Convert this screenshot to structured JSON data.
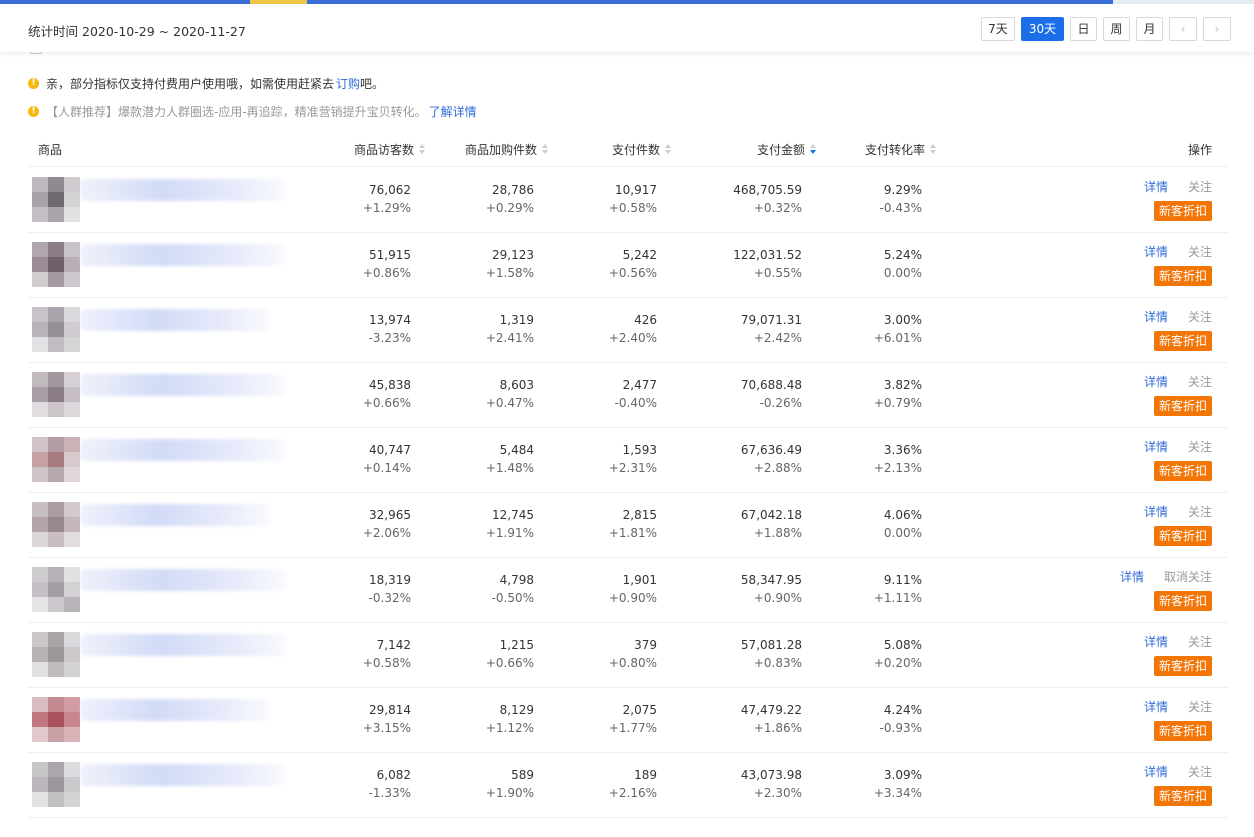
{
  "header": {
    "period_label": "统计时间",
    "date_start": "2020-10-29",
    "date_sep": "~",
    "date_end": "2020-11-27",
    "buttons": {
      "d7": "7天",
      "d30": "30天",
      "day": "日",
      "week": "周",
      "month": "月",
      "prev": "‹",
      "next": "›"
    },
    "active_button": "30天"
  },
  "notices": [
    {
      "text": "亲，部分指标仅支持付费用户使用哦，如需使用赶紧去",
      "link": "订购",
      "suffix": "吧。"
    },
    {
      "text": "【人群推荐】爆款潜力人群圈选-应用-再追踪，精准营销提升宝贝转化。",
      "link": "了解详情",
      "suffix": ""
    }
  ],
  "table": {
    "columns": {
      "product": "商品",
      "visitors": "商品访客数",
      "cart": "商品加购件数",
      "paid_items": "支付件数",
      "paid_amount": "支付金额",
      "conversion": "支付转化率",
      "actions": "操作"
    },
    "rows": [
      {
        "visitors": "76,062",
        "visitors_chg": "+1.29%",
        "cart": "28,786",
        "cart_chg": "+0.29%",
        "paid_items": "10,917",
        "paid_items_chg": "+0.58%",
        "amount": "468,705.59",
        "amount_chg": "+0.32%",
        "conv": "9.29%",
        "conv_chg": "-0.43%",
        "detail": "详情",
        "follow": "关注",
        "promo": "新客折扣"
      },
      {
        "visitors": "51,915",
        "visitors_chg": "+0.86%",
        "cart": "29,123",
        "cart_chg": "+1.58%",
        "paid_items": "5,242",
        "paid_items_chg": "+0.56%",
        "amount": "122,031.52",
        "amount_chg": "+0.55%",
        "conv": "5.24%",
        "conv_chg": "0.00%",
        "detail": "详情",
        "follow": "关注",
        "promo": "新客折扣"
      },
      {
        "visitors": "13,974",
        "visitors_chg": "-3.23%",
        "cart": "1,319",
        "cart_chg": "+2.41%",
        "paid_items": "426",
        "paid_items_chg": "+2.40%",
        "amount": "79,071.31",
        "amount_chg": "+2.42%",
        "conv": "3.00%",
        "conv_chg": "+6.01%",
        "detail": "详情",
        "follow": "关注",
        "promo": "新客折扣"
      },
      {
        "visitors": "45,838",
        "visitors_chg": "+0.66%",
        "cart": "8,603",
        "cart_chg": "+0.47%",
        "paid_items": "2,477",
        "paid_items_chg": "-0.40%",
        "amount": "70,688.48",
        "amount_chg": "-0.26%",
        "conv": "3.82%",
        "conv_chg": "+0.79%",
        "detail": "详情",
        "follow": "关注",
        "promo": "新客折扣"
      },
      {
        "visitors": "40,747",
        "visitors_chg": "+0.14%",
        "cart": "5,484",
        "cart_chg": "+1.48%",
        "paid_items": "1,593",
        "paid_items_chg": "+2.31%",
        "amount": "67,636.49",
        "amount_chg": "+2.88%",
        "conv": "3.36%",
        "conv_chg": "+2.13%",
        "detail": "详情",
        "follow": "关注",
        "promo": "新客折扣"
      },
      {
        "visitors": "32,965",
        "visitors_chg": "+2.06%",
        "cart": "12,745",
        "cart_chg": "+1.91%",
        "paid_items": "2,815",
        "paid_items_chg": "+1.81%",
        "amount": "67,042.18",
        "amount_chg": "+1.88%",
        "conv": "4.06%",
        "conv_chg": "0.00%",
        "detail": "详情",
        "follow": "关注",
        "promo": "新客折扣"
      },
      {
        "visitors": "18,319",
        "visitors_chg": "-0.32%",
        "cart": "4,798",
        "cart_chg": "-0.50%",
        "paid_items": "1,901",
        "paid_items_chg": "+0.90%",
        "amount": "58,347.95",
        "amount_chg": "+0.90%",
        "conv": "9.11%",
        "conv_chg": "+1.11%",
        "detail": "详情",
        "follow": "取消关注",
        "promo": "新客折扣"
      },
      {
        "visitors": "7,142",
        "visitors_chg": "+0.58%",
        "cart": "1,215",
        "cart_chg": "+0.66%",
        "paid_items": "379",
        "paid_items_chg": "+0.80%",
        "amount": "57,081.28",
        "amount_chg": "+0.83%",
        "conv": "5.08%",
        "conv_chg": "+0.20%",
        "detail": "详情",
        "follow": "关注",
        "promo": "新客折扣"
      },
      {
        "visitors": "29,814",
        "visitors_chg": "+3.15%",
        "cart": "8,129",
        "cart_chg": "+1.12%",
        "paid_items": "2,075",
        "paid_items_chg": "+1.77%",
        "amount": "47,479.22",
        "amount_chg": "+1.86%",
        "conv": "4.24%",
        "conv_chg": "-0.93%",
        "detail": "详情",
        "follow": "关注",
        "promo": "新客折扣"
      },
      {
        "visitors": "6,082",
        "visitors_chg": "-1.33%",
        "cart": "589",
        "cart_chg": "+1.90%",
        "paid_items": "189",
        "paid_items_chg": "+2.16%",
        "amount": "43,073.98",
        "amount_chg": "+2.30%",
        "conv": "3.09%",
        "conv_chg": "+3.34%",
        "detail": "详情",
        "follow": "关注",
        "promo": "新客折扣"
      }
    ]
  },
  "colors": {
    "accent": "#1b6ee8",
    "link": "#2f6bd6",
    "promo": "#f27506",
    "warn": "#f5b80f"
  }
}
